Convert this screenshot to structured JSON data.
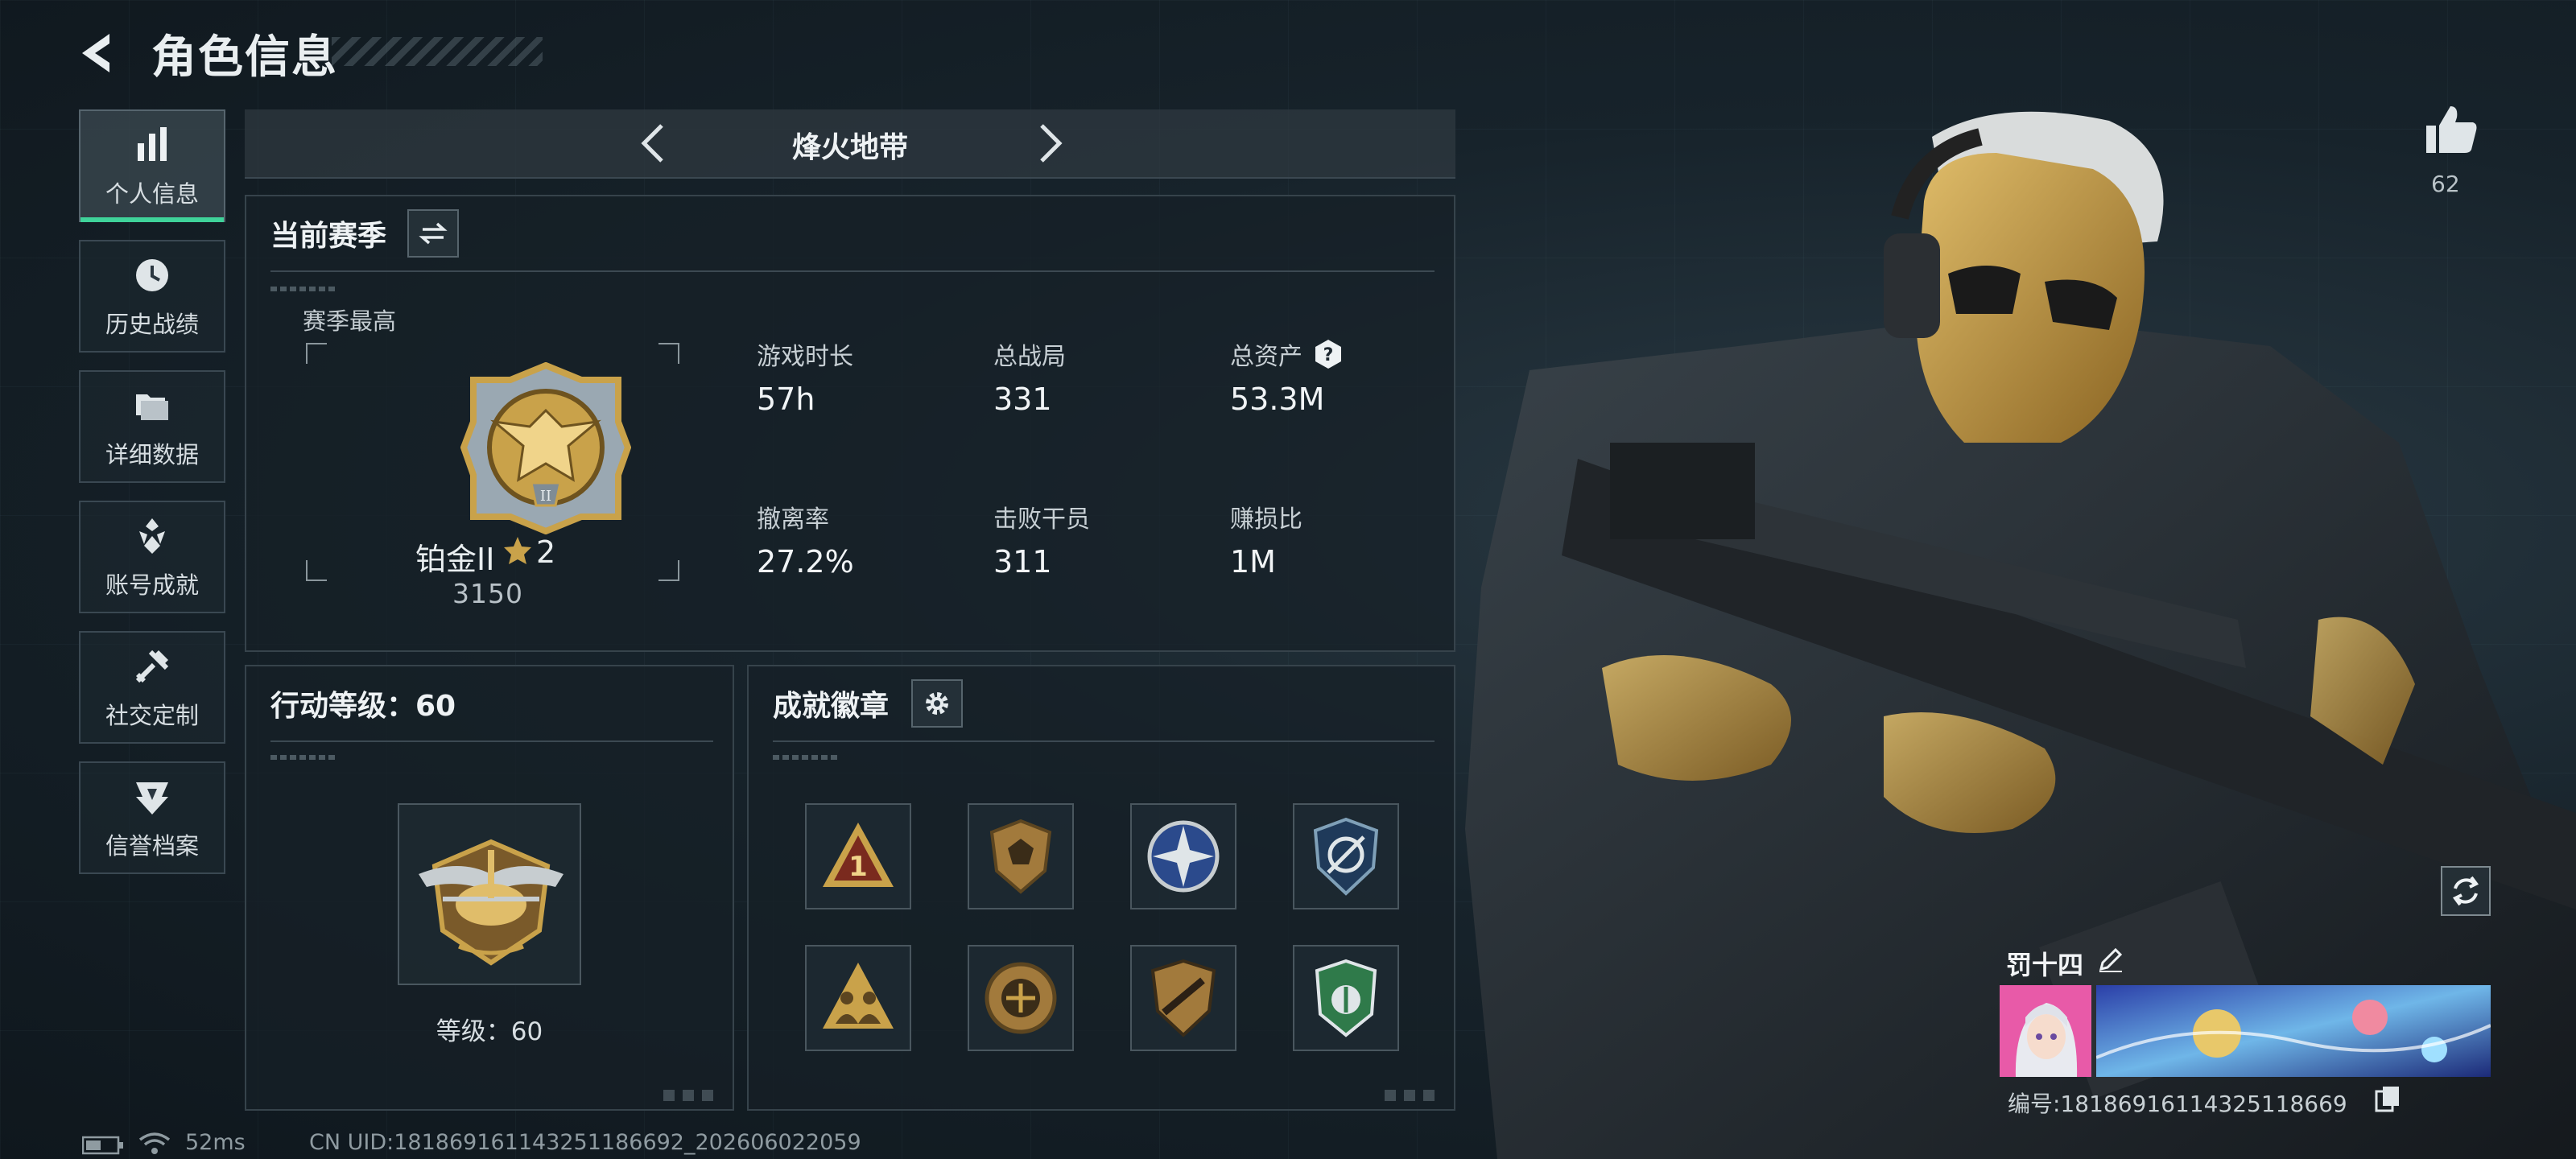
{
  "header": {
    "title": "角色信息"
  },
  "nav": {
    "items": [
      {
        "label": "个人信息",
        "icon": "bar-chart-icon",
        "active": true
      },
      {
        "label": "历史战绩",
        "icon": "clock-history-icon",
        "active": false
      },
      {
        "label": "详细数据",
        "icon": "folders-icon",
        "active": false
      },
      {
        "label": "账号成就",
        "icon": "achievement-icon",
        "active": false
      },
      {
        "label": "社交定制",
        "icon": "tools-icon",
        "active": false
      },
      {
        "label": "信誉档案",
        "icon": "shield-badge-icon",
        "active": false
      }
    ]
  },
  "mode_tabs": {
    "current": "烽火地带"
  },
  "season": {
    "title": "当前赛季",
    "best_label": "赛季最高",
    "rank_name": "铂金II",
    "rank_stars": "2",
    "rank_score": "3150",
    "stats": [
      {
        "label": "游戏时长",
        "value": "57h"
      },
      {
        "label": "总战局",
        "value": "331"
      },
      {
        "label": "总资产",
        "value": "53.3M",
        "help": true
      },
      {
        "label": "撤离率",
        "value": "27.2%"
      },
      {
        "label": "击败干员",
        "value": "311"
      },
      {
        "label": "赚损比",
        "value": "1M"
      }
    ]
  },
  "level": {
    "title": "行动等级：60",
    "caption": "等级：60"
  },
  "badges": {
    "title": "成就徽章",
    "items": [
      {
        "icon": "triangle-one-badge-icon"
      },
      {
        "icon": "bronze-shield-badge-icon"
      },
      {
        "icon": "blue-compass-badge-icon"
      },
      {
        "icon": "blue-crest-badge-icon"
      },
      {
        "icon": "triangle-squad-badge-icon"
      },
      {
        "icon": "round-emblem-badge-icon"
      },
      {
        "icon": "rifle-shield-badge-icon"
      },
      {
        "icon": "green-shield-badge-icon"
      }
    ]
  },
  "profile": {
    "likes": "62",
    "name": "罚十四",
    "id_text": "编号:18186916114325118669",
    "avatar_icon": "anime-avatar-icon",
    "banner_icon": "space-banner-icon"
  },
  "status_bar": {
    "ping": "52ms",
    "uid": "CN UID:181869161143251186692_202606022059"
  },
  "colors": {
    "accent_green": "#3fd39a",
    "gold": "#c9a24a",
    "panel_border": "#36434b"
  }
}
